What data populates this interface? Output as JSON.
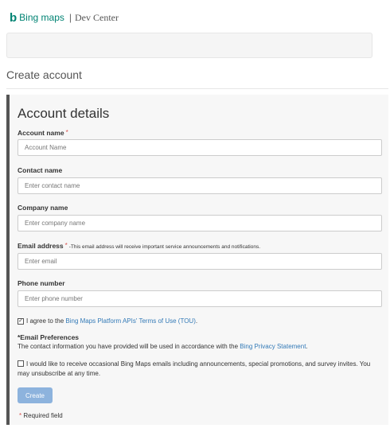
{
  "brand": {
    "logo_mark": "b",
    "logo_text": "Bing maps",
    "separator": "|",
    "subtitle": "Dev Center"
  },
  "page": {
    "title": "Create account"
  },
  "form": {
    "heading": "Account details",
    "fields": [
      {
        "label": "Account name",
        "required_mark": "*",
        "placeholder": "Account Name"
      },
      {
        "label": "Contact name",
        "placeholder": "Enter contact name"
      },
      {
        "label": "Company name",
        "placeholder": "Enter company name"
      },
      {
        "label": "Email address",
        "required_mark": "*",
        "note": "-This email address will receive important service announcements and notifications.",
        "placeholder": "Enter email"
      },
      {
        "label": "Phone number",
        "placeholder": "Enter phone number"
      }
    ],
    "agree": {
      "checked": true,
      "check_glyph": "✓",
      "prefix": "I agree to the ",
      "link_text": "Bing Maps Platform APIs' Terms of Use (TOU)",
      "suffix": "."
    },
    "email_preferences": {
      "title": "*Email Preferences",
      "text": "The contact information you have provided will be used in accordance with the ",
      "link_text": "Bing Privacy Statement",
      "suffix": "."
    },
    "optin": {
      "checked": false,
      "text": "I would like to receive occasional Bing Maps emails including announcements, special promotions, and survey invites. You may unsubscribe at any time."
    },
    "create_label": "Create",
    "required_star": "*",
    "required_text": " Required field"
  },
  "colors": {
    "brand": "#008373",
    "panel_bg": "#f7f7f7",
    "panel_accent": "#555555",
    "link": "#337ab7",
    "button_bg": "#8db3dd",
    "required": "#d9534f"
  }
}
